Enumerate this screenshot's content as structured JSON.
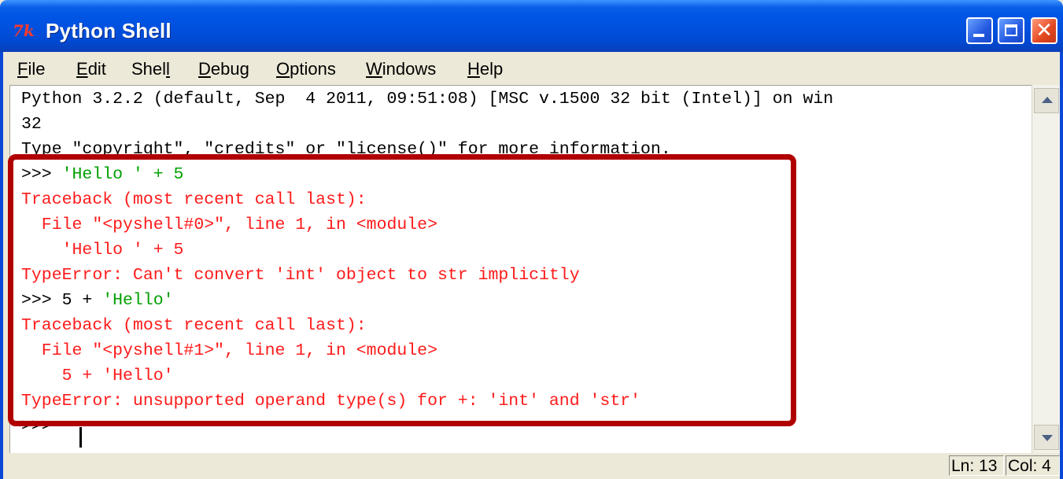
{
  "window": {
    "title": "Python Shell",
    "icon": "python-tk-icon",
    "icon_glyph": "7k",
    "controls": [
      "minimize-icon",
      "maximize-icon",
      "close-icon"
    ]
  },
  "menu": {
    "items": [
      {
        "label": "File",
        "mnemonic": "F"
      },
      {
        "label": "Edit",
        "mnemonic": "E"
      },
      {
        "label": "Shell",
        "mnemonic": "l"
      },
      {
        "label": "Debug",
        "mnemonic": "D"
      },
      {
        "label": "Options",
        "mnemonic": "O"
      },
      {
        "label": "Windows",
        "mnemonic": "W"
      },
      {
        "label": "Help",
        "mnemonic": "H"
      }
    ]
  },
  "shell": {
    "lines": [
      {
        "text": "Python 3.2.2 (default, Sep  4 2011, 09:51:08) [MSC v.1500 32 bit (Intel)] on win"
      },
      {
        "text": "32"
      },
      {
        "text": "Type \"copyright\", \"credits\" or \"license()\" for more information."
      },
      {
        "prompt": ">>> ",
        "code": "'Hello ' + 5"
      },
      {
        "text": "Traceback (most recent call last):"
      },
      {
        "text": "  File \"<pyshell#0>\", line 1, in <module>"
      },
      {
        "text": "    'Hello ' + 5"
      },
      {
        "text": "TypeError: Can't convert 'int' object to str implicitly"
      },
      {
        "prompt": ">>> ",
        "code_a": "5 + ",
        "code_b": "'Hello'"
      },
      {
        "text": "Traceback (most recent call last):"
      },
      {
        "text": "  File \"<pyshell#1>\", line 1, in <module>"
      },
      {
        "text": "    5 + 'Hello'"
      },
      {
        "text": "TypeError: unsupported operand type(s) for +: 'int' and 'str'"
      },
      {
        "prompt": ">>> "
      }
    ]
  },
  "status": {
    "ln": "Ln: 13",
    "col": "Col: 4"
  },
  "colors": {
    "error": "#ff1a1a",
    "string": "#00a000",
    "highlight_border": "#b00000"
  }
}
